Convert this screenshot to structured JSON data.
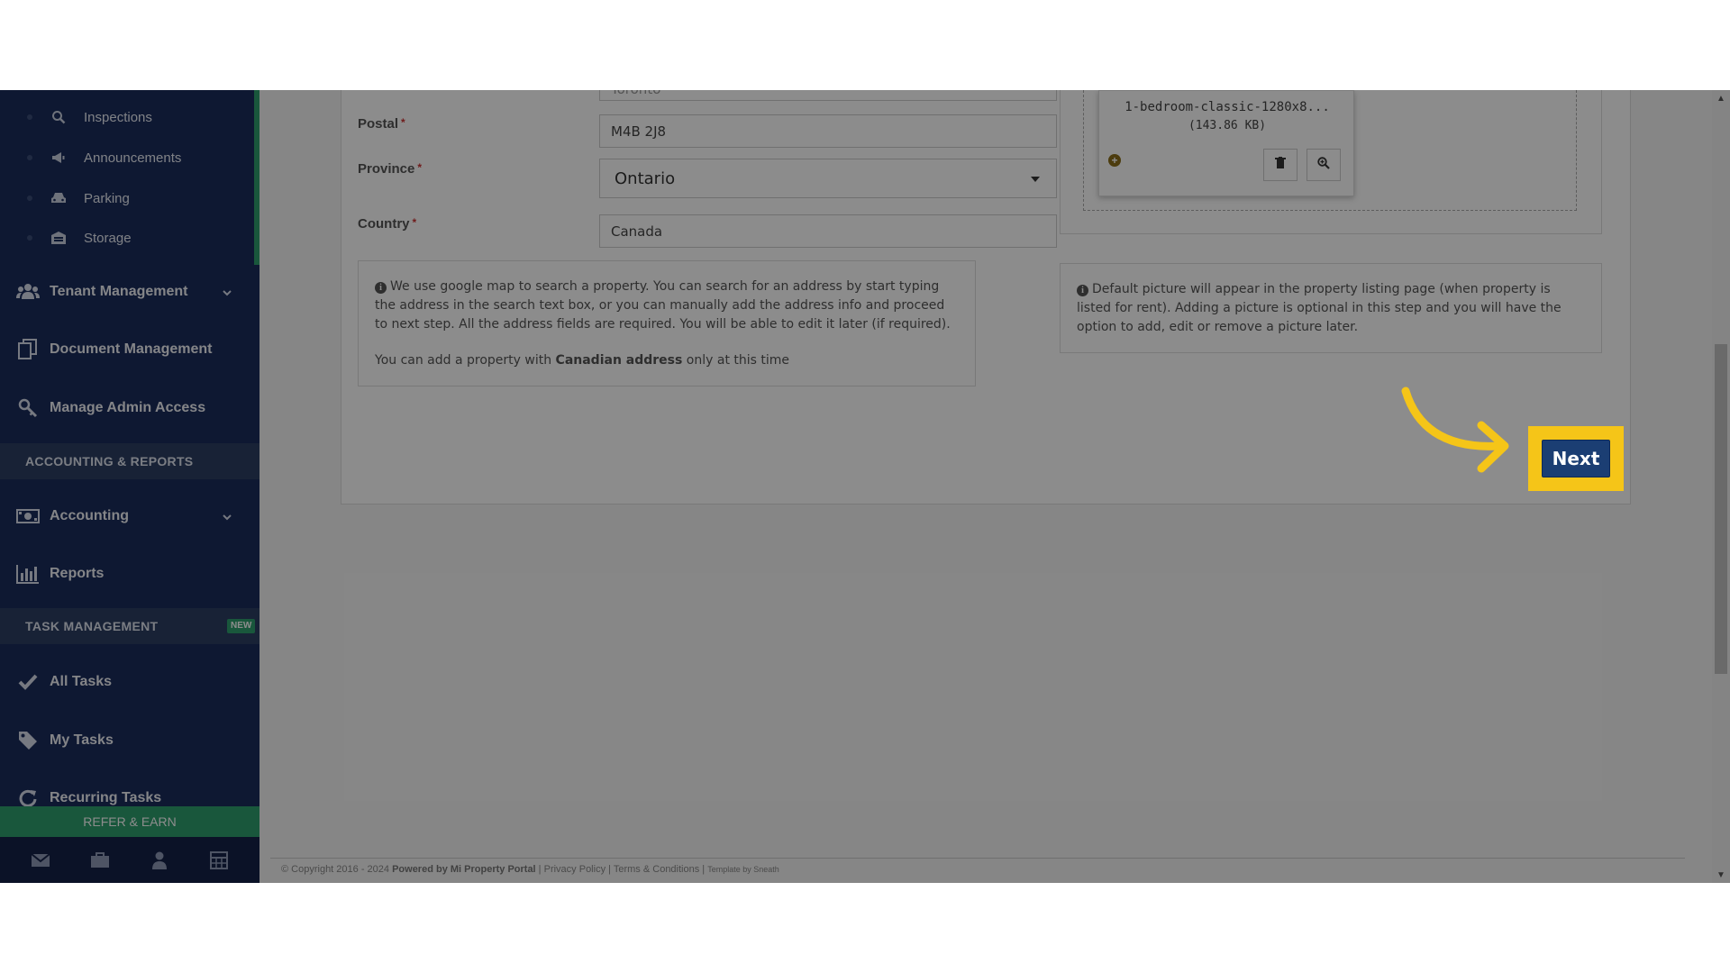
{
  "sidebar": {
    "sub_items": [
      {
        "label": "Inspections",
        "icon": "search-icon"
      },
      {
        "label": "Announcements",
        "icon": "megaphone-icon"
      },
      {
        "label": "Parking",
        "icon": "car-icon"
      },
      {
        "label": "Storage",
        "icon": "storage-icon"
      }
    ],
    "nav": {
      "tenant_management": "Tenant Management",
      "document_management": "Document Management",
      "manage_admin_access": "Manage Admin Access",
      "accounting": "Accounting",
      "reports": "Reports",
      "all_tasks": "All Tasks",
      "my_tasks": "My Tasks",
      "recurring_tasks": "Recurring Tasks"
    },
    "sections": {
      "accounting_reports": "ACCOUNTING & REPORTS",
      "task_management": "TASK MANAGEMENT",
      "new_badge": "NEW"
    },
    "refer_earn": "REFER & EARN"
  },
  "form": {
    "city_value": "Toronto",
    "postal_label": "Postal",
    "postal_value": "M4B 2J8",
    "province_label": "Province",
    "province_value": "Ontario",
    "country_label": "Country",
    "country_value": "Canada",
    "required_mark": "*"
  },
  "info_left": {
    "text": "We use google map to search a property. You can search for an address by start typing the address in the search text box, or you can manually add the address info and proceed to next step. All the address fields are required. You will be able to edit it later (if required).",
    "note_prefix": "You can add a property with ",
    "note_bold": "Canadian address",
    "note_suffix": " only at this time"
  },
  "upload": {
    "file_name": "1-bedroom-classic-1280x8...",
    "file_size": "(143.86 KB)"
  },
  "info_right": {
    "text": "Default picture will appear in the property listing page (when property is listed for rent). Adding a picture is optional in this step and you will have the option to add, edit or remove a picture later."
  },
  "actions": {
    "next_label": "Next"
  },
  "footer": {
    "copyright": "© Copyright 2016 - 2024",
    "powered_by": "Powered by Mi Property Portal",
    "privacy": "Privacy Policy",
    "terms": "Terms & Conditions",
    "template": "Template by Sneath"
  },
  "colors": {
    "sidebar_bg": "#1a2c5b",
    "accent_green": "#2e9e6e",
    "next_button": "#1b3e73",
    "highlight": "#f5c518"
  }
}
